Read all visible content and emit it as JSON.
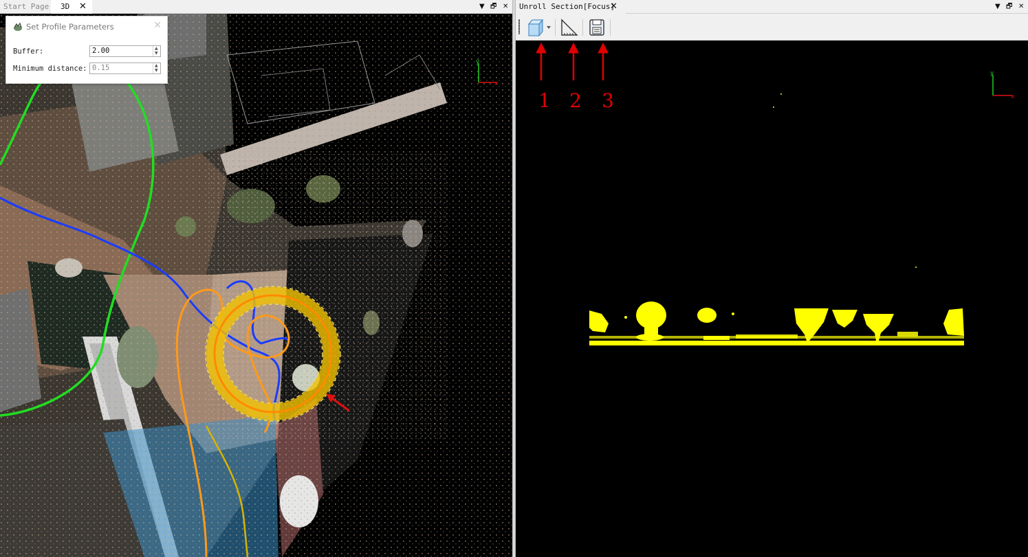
{
  "left_tabs": {
    "start_page": "Start Page",
    "view3d": "3D",
    "close_glyph": "✕"
  },
  "pane_controls": {
    "dropdown_glyph": "▼",
    "restore_glyph": "🗗",
    "close_glyph": "✕"
  },
  "dialog": {
    "title": "Set Profile Parameters",
    "close_glyph": "✕",
    "buffer_label": "Buffer:",
    "buffer_value": "2.00",
    "min_distance_label": "Minimum distance:",
    "min_distance_value": "0.15"
  },
  "right_tab": {
    "label": "Unroll Section[Focus]",
    "close_glyph": "✕"
  },
  "toolbar": {
    "tools": [
      {
        "name": "view-cube-icon",
        "has_dropdown": true
      },
      {
        "name": "measure-ruler-icon"
      },
      {
        "name": "save-icon"
      }
    ]
  },
  "callouts": [
    "1",
    "2",
    "3"
  ],
  "colors": {
    "profile_points": "#ffff00",
    "callout_red": "#e00000",
    "track_green": "#22dd22",
    "track_blue": "#1a3cff",
    "track_orange": "#ff9a1a",
    "buffer_yellow": "#f2c200"
  },
  "axis_labels": {
    "x": "x",
    "y": "y"
  }
}
